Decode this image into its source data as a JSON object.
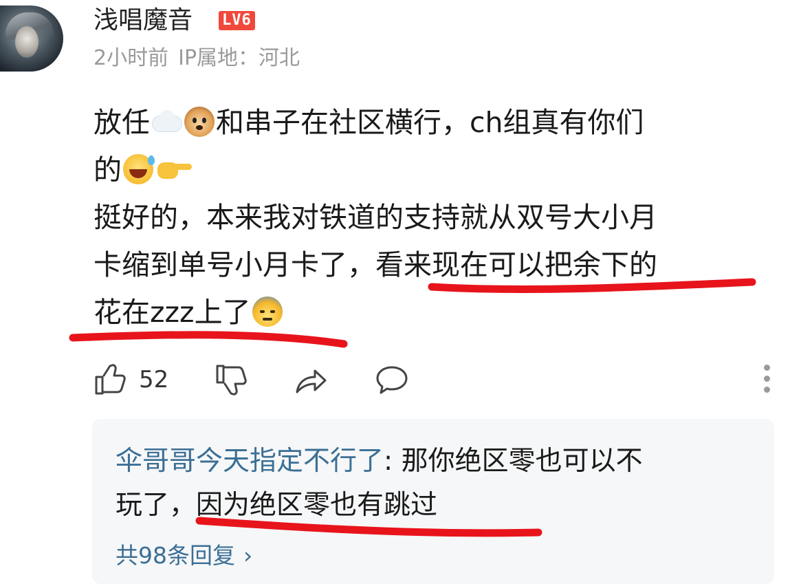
{
  "post": {
    "username": "浅唱魔音",
    "level": "LV6",
    "time": "2小时前",
    "ip_location": "IP属地：河北",
    "content": {
      "line1_a": "放任",
      "line1_b": "和串子在社区横行，ch组真有你们",
      "line2": "的",
      "line3": "挺好的，本来我对铁道的支持就从双号大小月",
      "line4_a": "卡缩到单号小月卡了，",
      "line4_b": "看来现在可以把余下的",
      "line5": "花在zzz上了"
    },
    "emojis": [
      "cloud-emoji",
      "dog-emoji",
      "sweat-smile-emoji",
      "pointing-right-emoji",
      "cold-sweat-emoji"
    ],
    "likes": "52"
  },
  "reply": {
    "user": "伞哥哥今天指定不行了",
    "separator": ": ",
    "text_line1": "那你绝区零也可以不",
    "text_line2_a": "玩了，",
    "text_line2_b": "因为绝区零也有跳过",
    "count_label": "共98条回复",
    "chevron": "›"
  },
  "colors": {
    "accent_link": "#3b6f95",
    "level_badge": "#f0493c",
    "underline_marker": "#e8141b",
    "meta_text": "#9a9a9a"
  }
}
